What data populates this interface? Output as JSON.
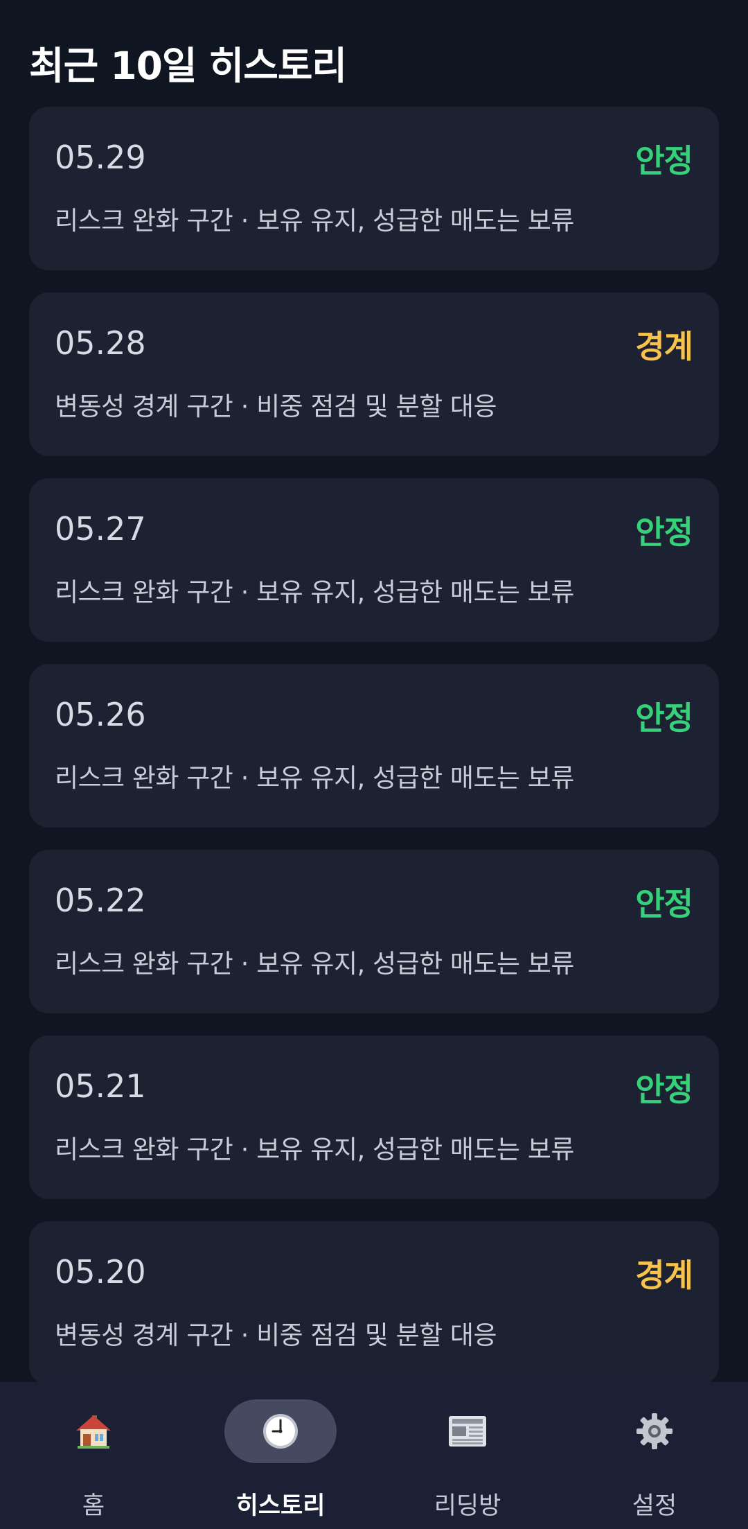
{
  "header": {
    "title": "최근 10일 히스토리"
  },
  "colors": {
    "background": "#0f1521",
    "card": "#1c2232",
    "stable": "#35d27a",
    "warning": "#f7c34c",
    "nav_background": "#1b2035",
    "nav_active_pill": "#464a60"
  },
  "history": [
    {
      "date": "05.29",
      "status": "안정",
      "status_type": "stable",
      "description": "리스크 완화 구간 · 보유 유지, 성급한 매도는 보류"
    },
    {
      "date": "05.28",
      "status": "경계",
      "status_type": "warning",
      "description": "변동성 경계 구간 · 비중 점검 및 분할 대응"
    },
    {
      "date": "05.27",
      "status": "안정",
      "status_type": "stable",
      "description": "리스크 완화 구간 · 보유 유지, 성급한 매도는 보류"
    },
    {
      "date": "05.26",
      "status": "안정",
      "status_type": "stable",
      "description": "리스크 완화 구간 · 보유 유지, 성급한 매도는 보류"
    },
    {
      "date": "05.22",
      "status": "안정",
      "status_type": "stable",
      "description": "리스크 완화 구간 · 보유 유지, 성급한 매도는 보류"
    },
    {
      "date": "05.21",
      "status": "안정",
      "status_type": "stable",
      "description": "리스크 완화 구간 · 보유 유지, 성급한 매도는 보류"
    },
    {
      "date": "05.20",
      "status": "경계",
      "status_type": "warning",
      "description": "변동성 경계 구간 · 비중 점검 및 분할 대응"
    }
  ],
  "nav": {
    "items": [
      {
        "label": "홈",
        "icon": "house-icon",
        "active": false
      },
      {
        "label": "히스토리",
        "icon": "clock-icon",
        "active": true
      },
      {
        "label": "리딩방",
        "icon": "newspaper-icon",
        "active": false
      },
      {
        "label": "설정",
        "icon": "gear-icon",
        "active": false
      }
    ]
  }
}
